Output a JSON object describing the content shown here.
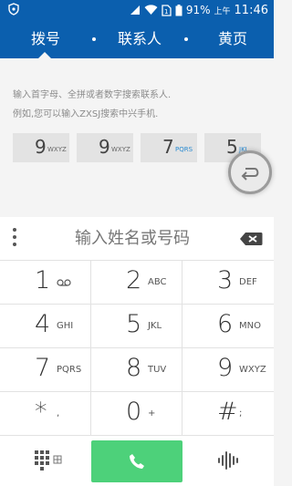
{
  "status": {
    "battery": "91%",
    "ampm": "上午",
    "time": "11:46"
  },
  "tabs": [
    {
      "label": "拨号"
    },
    {
      "label": "联系人"
    },
    {
      "label": "黄页"
    }
  ],
  "hints": {
    "line1": "输入首字母、全拼或者数字搜索联系人.",
    "line2": "例如,您可以输入ZXSJ搜索中兴手机."
  },
  "example_keys": [
    {
      "digit": "9",
      "letters": "WXYZ"
    },
    {
      "digit": "9",
      "letters": "WXYZ"
    },
    {
      "digit": "7",
      "letters": "PQRS"
    },
    {
      "digit": "5",
      "letters": "JKL"
    }
  ],
  "input": {
    "placeholder": "输入姓名或号码"
  },
  "keypad": [
    {
      "digit": "1",
      "letters": "voicemail"
    },
    {
      "digit": "2",
      "letters": "ABC"
    },
    {
      "digit": "3",
      "letters": "DEF"
    },
    {
      "digit": "4",
      "letters": "GHI"
    },
    {
      "digit": "5",
      "letters": "JKL"
    },
    {
      "digit": "6",
      "letters": "MNO"
    },
    {
      "digit": "7",
      "letters": "PQRS"
    },
    {
      "digit": "8",
      "letters": "TUV"
    },
    {
      "digit": "9",
      "letters": "WXYZ"
    },
    {
      "digit": "*",
      "letters": ","
    },
    {
      "digit": "0",
      "letters": "+"
    },
    {
      "digit": "#",
      "letters": ";"
    }
  ],
  "colors": {
    "header": "#0b5fae",
    "call": "#4dd17a",
    "accent_letters": "#2a8bd1"
  },
  "icons": {
    "status_left": "shield-icon",
    "signal": "signal-icon",
    "wifi": "wifi-icon",
    "sim": "sim-icon",
    "battery": "battery-icon",
    "float": "back-arrow-icon",
    "delete": "backspace-icon",
    "dialpad": "dialpad-grid-icon",
    "call": "phone-icon",
    "voice": "voice-wave-icon"
  }
}
